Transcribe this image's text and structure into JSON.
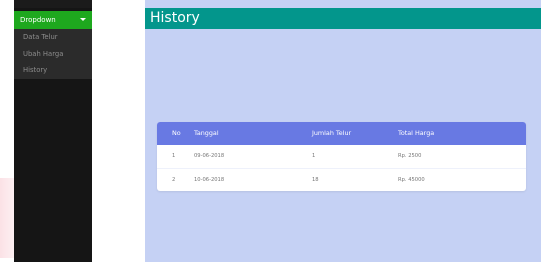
{
  "sidebar": {
    "dropdown_label": "Dropdown",
    "items": [
      {
        "label": "Data Telur"
      },
      {
        "label": "Ubah Harga"
      },
      {
        "label": "History"
      }
    ]
  },
  "header": {
    "title": "History"
  },
  "table": {
    "columns": [
      "No",
      "Tanggal",
      "Jumlah Telur",
      "Total Harga"
    ],
    "rows": [
      [
        "1",
        "09-06-2018",
        "1",
        "Rp. 2500"
      ],
      [
        "2",
        "10-06-2018",
        "18",
        "Rp. 45000"
      ]
    ]
  },
  "colors": {
    "sidebar_bg": "#151515",
    "dropdown_bg": "#1ea81e",
    "header_bg": "#03968c",
    "content_bg": "#c5d1f4",
    "table_header_bg": "#6879e3"
  }
}
